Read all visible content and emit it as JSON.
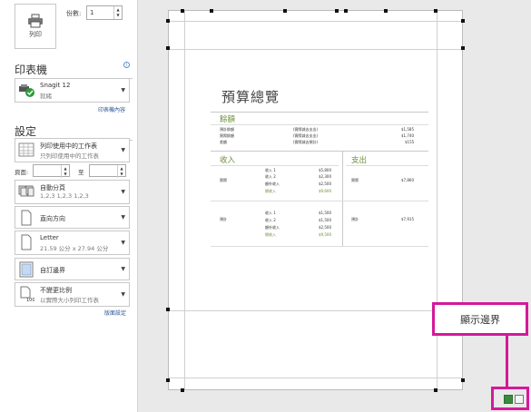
{
  "print": {
    "print_button_label": "列印",
    "copies_label": "份數:",
    "copies_value": "1"
  },
  "printer": {
    "section_title": "印表機",
    "info_icon": "i",
    "name": "Snagit 12",
    "status": "就緒",
    "properties_link": "印表機內容"
  },
  "settings": {
    "section_title": "設定",
    "scope": {
      "title": "列印使用中的工作表",
      "subtitle": "只列印使用中的工作表"
    },
    "pages_label": "頁面:",
    "pages_to_label": "至",
    "pages_from_value": "",
    "pages_to_value": "",
    "collate": {
      "title": "自動分頁",
      "subtitle": "1,2,3   1,2,3   1,2,3"
    },
    "orientation": {
      "title": "直向方向"
    },
    "paper": {
      "title": "Letter",
      "subtitle": "21.59 公分 x 27.94 公分"
    },
    "margins": {
      "title": "自訂邊界"
    },
    "scaling": {
      "title": "不變更比例",
      "subtitle": "以實際大小列印工作表"
    },
    "page_setup_link": "版面設定"
  },
  "document": {
    "title": "預算總覽",
    "summary_heading": "餘額",
    "summary_rows": [
      {
        "label": "預計餘額",
        "ref": "(實際減去支出)",
        "value": "$1,585"
      },
      {
        "label": "實際餘額",
        "ref": "(實際減去支出)",
        "value": "$1,740"
      },
      {
        "label": "差額",
        "ref": "(實際減去預計)",
        "value": "$155"
      }
    ],
    "income_heading": "收入",
    "expense_heading": "支出",
    "actual_label": "實際",
    "projected_label": "預計",
    "actual_income": [
      {
        "label": "收入 1",
        "value": "$5,800"
      },
      {
        "label": "收入 2",
        "value": "$2,300"
      },
      {
        "label": "額外收入",
        "value": "$2,500"
      },
      {
        "label": "總收入",
        "value": "$9,600"
      }
    ],
    "projected_income": [
      {
        "label": "收入 1",
        "value": "$1,500"
      },
      {
        "label": "收入 2",
        "value": "$1,500"
      },
      {
        "label": "額外收入",
        "value": "$2,500"
      },
      {
        "label": "總收入",
        "value": "$9,500"
      }
    ],
    "actual_expense": "$7,860",
    "projected_expense": "$7,915"
  },
  "callout": {
    "label": "顯示邊界"
  },
  "colors": {
    "callout": "#d4199a",
    "heading_green": "#6b8e3a",
    "link_blue": "#2b5797"
  }
}
